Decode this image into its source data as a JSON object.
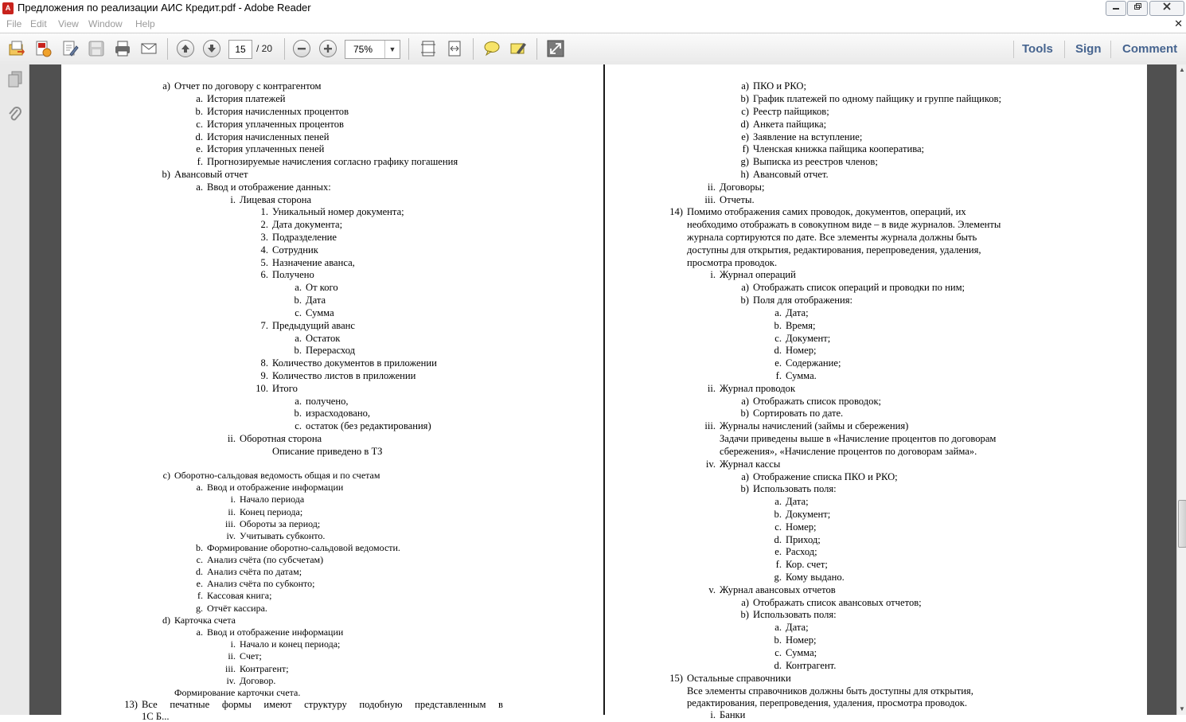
{
  "window": {
    "title": "Предложения по реализации АИС Кредит.pdf - Adobe Reader",
    "app_icon": "pdf-icon"
  },
  "menu": {
    "items": [
      "File",
      "Edit",
      "View",
      "Window",
      "Help"
    ],
    "close_glyph": "✕"
  },
  "toolbar": {
    "page_current": "15",
    "page_total": "/ 20",
    "zoom": "75%",
    "tools_label": "Tools",
    "sign_label": "Sign",
    "comment_label": "Comment"
  },
  "colors": {
    "accent": "#46648f",
    "viewer_bg": "#505050",
    "pdf_red": "#c8231d"
  },
  "left_page": [
    {
      "m": "a)",
      "t": "Отчет по договору с контрагентом"
    },
    {
      "m": "a.",
      "t": "История платежей"
    },
    {
      "m": "b.",
      "t": "История начисленных процентов"
    },
    {
      "m": "c.",
      "t": "История уплаченных процентов"
    },
    {
      "m": "d.",
      "t": "История начисленных пеней"
    },
    {
      "m": "e.",
      "t": "История уплаченных пеней"
    },
    {
      "m": "f.",
      "t": "Прогнозируемые начисления согласно графику погашения"
    },
    {
      "m": "b)",
      "t": "Авансовый отчет"
    },
    {
      "m": "a.",
      "t": "Ввод и отображение данных:"
    },
    {
      "m": "i.",
      "t": "Лицевая сторона"
    },
    {
      "m": "1.",
      "t": "Уникальный номер документа;"
    },
    {
      "m": "2.",
      "t": "Дата документа;"
    },
    {
      "m": "3.",
      "t": "Подразделение"
    },
    {
      "m": "4.",
      "t": "Сотрудник"
    },
    {
      "m": "5.",
      "t": "Назначение аванса,"
    },
    {
      "m": "6.",
      "t": "Получено"
    },
    {
      "m": "a.",
      "t": "От кого"
    },
    {
      "m": "b.",
      "t": "Дата"
    },
    {
      "m": "c.",
      "t": "Сумма"
    },
    {
      "m": "7.",
      "t": "Предыдущий аванс"
    },
    {
      "m": "a.",
      "t": "Остаток"
    },
    {
      "m": "b.",
      "t": "Перерасход"
    },
    {
      "m": "8.",
      "t": "Количество документов в приложении"
    },
    {
      "m": "9.",
      "t": "Количество листов в приложении"
    },
    {
      "m": "10.",
      "t": "Итого"
    },
    {
      "m": "a.",
      "t": "получено,"
    },
    {
      "m": "b.",
      "t": "израсходовано,"
    },
    {
      "m": "c.",
      "t": "остаток (без редактирования)"
    },
    {
      "m": "ii.",
      "t": "Оборотная сторона"
    },
    {
      "m": "",
      "t": "Описание приведено в ТЗ"
    },
    {
      "m": "c)",
      "t": "Оборотно-сальдовая ведомость общая и по счетам"
    },
    {
      "m": "a.",
      "t": "Ввод и отображение информации"
    },
    {
      "m": "i.",
      "t": "Начало периода"
    },
    {
      "m": "ii.",
      "t": "Конец периода;"
    },
    {
      "m": "iii.",
      "t": "Обороты за период;"
    },
    {
      "m": "iv.",
      "t": "Учитывать субконто."
    },
    {
      "m": "b.",
      "t": "Формирование оборотно-сальдовой ведомости."
    },
    {
      "m": "c.",
      "t": "Анализ счёта (по субсчетам)"
    },
    {
      "m": "d.",
      "t": "Анализ счёта по датам;"
    },
    {
      "m": "e.",
      "t": "Анализ счёта по субконто;"
    },
    {
      "m": "f.",
      "t": "Кассовая книга;"
    },
    {
      "m": "g.",
      "t": "Отчёт кассира."
    },
    {
      "m": "d)",
      "t": "Карточка счета"
    },
    {
      "m": "a.",
      "t": "Ввод и отображение информации"
    },
    {
      "m": "i.",
      "t": "Начало и конец периода;"
    },
    {
      "m": "ii.",
      "t": "Счет;"
    },
    {
      "m": "iii.",
      "t": "Контрагент;"
    },
    {
      "m": "iv.",
      "t": "Договор."
    },
    {
      "m": "",
      "t": "Формирование карточки счета."
    },
    {
      "m": "13)",
      "t": "Все печатные формы имеют структуру подобную представленным в"
    },
    {
      "m": "",
      "t": "1С Б..."
    }
  ],
  "right_page": [
    {
      "m": "a)",
      "t": "ПКО и РКО;"
    },
    {
      "m": "b)",
      "t": "График платежей по одному пайщику и группе пайщиков;"
    },
    {
      "m": "c)",
      "t": "Реестр пайщиков;"
    },
    {
      "m": "d)",
      "t": "Анкета пайщика;"
    },
    {
      "m": "e)",
      "t": "Заявление на вступление;"
    },
    {
      "m": "f)",
      "t": "Членская книжка пайщика кооператива;"
    },
    {
      "m": "g)",
      "t": "Выписка из реестров членов;"
    },
    {
      "m": "h)",
      "t": "Авансовый отчет."
    },
    {
      "m": "ii.",
      "t": "Договоры;"
    },
    {
      "m": "iii.",
      "t": "Отчеты."
    },
    {
      "m": "14)",
      "t": "Помимо отображения самих проводок, документов, операций, их"
    },
    {
      "m": "",
      "t": "необходимо отображать в совокупном виде – в виде журналов. Элементы"
    },
    {
      "m": "",
      "t": "журнала сортируются по дате. Все элементы журнала должны быть"
    },
    {
      "m": "",
      "t": "доступны для открытия, редактирования, перепроведения, удаления,"
    },
    {
      "m": "",
      "t": "просмотра проводок."
    },
    {
      "m": "i.",
      "t": "Журнал операций"
    },
    {
      "m": "a)",
      "t": "Отображать список операций и проводки по ним;"
    },
    {
      "m": "b)",
      "t": "Поля для отображения:"
    },
    {
      "m": "a.",
      "t": "Дата;"
    },
    {
      "m": "b.",
      "t": "Время;"
    },
    {
      "m": "c.",
      "t": "Документ;"
    },
    {
      "m": "d.",
      "t": "Номер;"
    },
    {
      "m": "e.",
      "t": "Содержание;"
    },
    {
      "m": "f.",
      "t": "Сумма."
    },
    {
      "m": "ii.",
      "t": "Журнал проводок"
    },
    {
      "m": "a)",
      "t": "Отображать список проводок;"
    },
    {
      "m": "b)",
      "t": "Сортировать по дате."
    },
    {
      "m": "iii.",
      "t": "Журналы начислений (займы и сбережения)"
    },
    {
      "m": "",
      "t": "Задачи приведены выше в «Начисление процентов по договорам"
    },
    {
      "m": "",
      "t": "сбережения», «Начисление процентов по договорам займа»."
    },
    {
      "m": "iv.",
      "t": "Журнал кассы"
    },
    {
      "m": "a)",
      "t": "Отображение списка ПКО и РКО;"
    },
    {
      "m": "b)",
      "t": "Использовать поля:"
    },
    {
      "m": "a.",
      "t": "Дата;"
    },
    {
      "m": "b.",
      "t": "Документ;"
    },
    {
      "m": "c.",
      "t": "Номер;"
    },
    {
      "m": "d.",
      "t": "Приход;"
    },
    {
      "m": "e.",
      "t": "Расход;"
    },
    {
      "m": "f.",
      "t": "Кор. счет;"
    },
    {
      "m": "g.",
      "t": "Кому выдано."
    },
    {
      "m": "v.",
      "t": "Журнал авансовых отчетов"
    },
    {
      "m": "a)",
      "t": "Отображать список авансовых отчетов;"
    },
    {
      "m": "b)",
      "t": "Использовать поля:"
    },
    {
      "m": "a.",
      "t": "Дата;"
    },
    {
      "m": "b.",
      "t": "Номер;"
    },
    {
      "m": "c.",
      "t": "Сумма;"
    },
    {
      "m": "d.",
      "t": "Контрагент."
    },
    {
      "m": "15)",
      "t": "Остальные справочники"
    },
    {
      "m": "",
      "t": "Все элементы справочников должны быть доступны для открытия,"
    },
    {
      "m": "",
      "t": "редактирования, перепроведения, удаления, просмотра проводок."
    },
    {
      "m": "i.",
      "t": "Банки"
    }
  ]
}
